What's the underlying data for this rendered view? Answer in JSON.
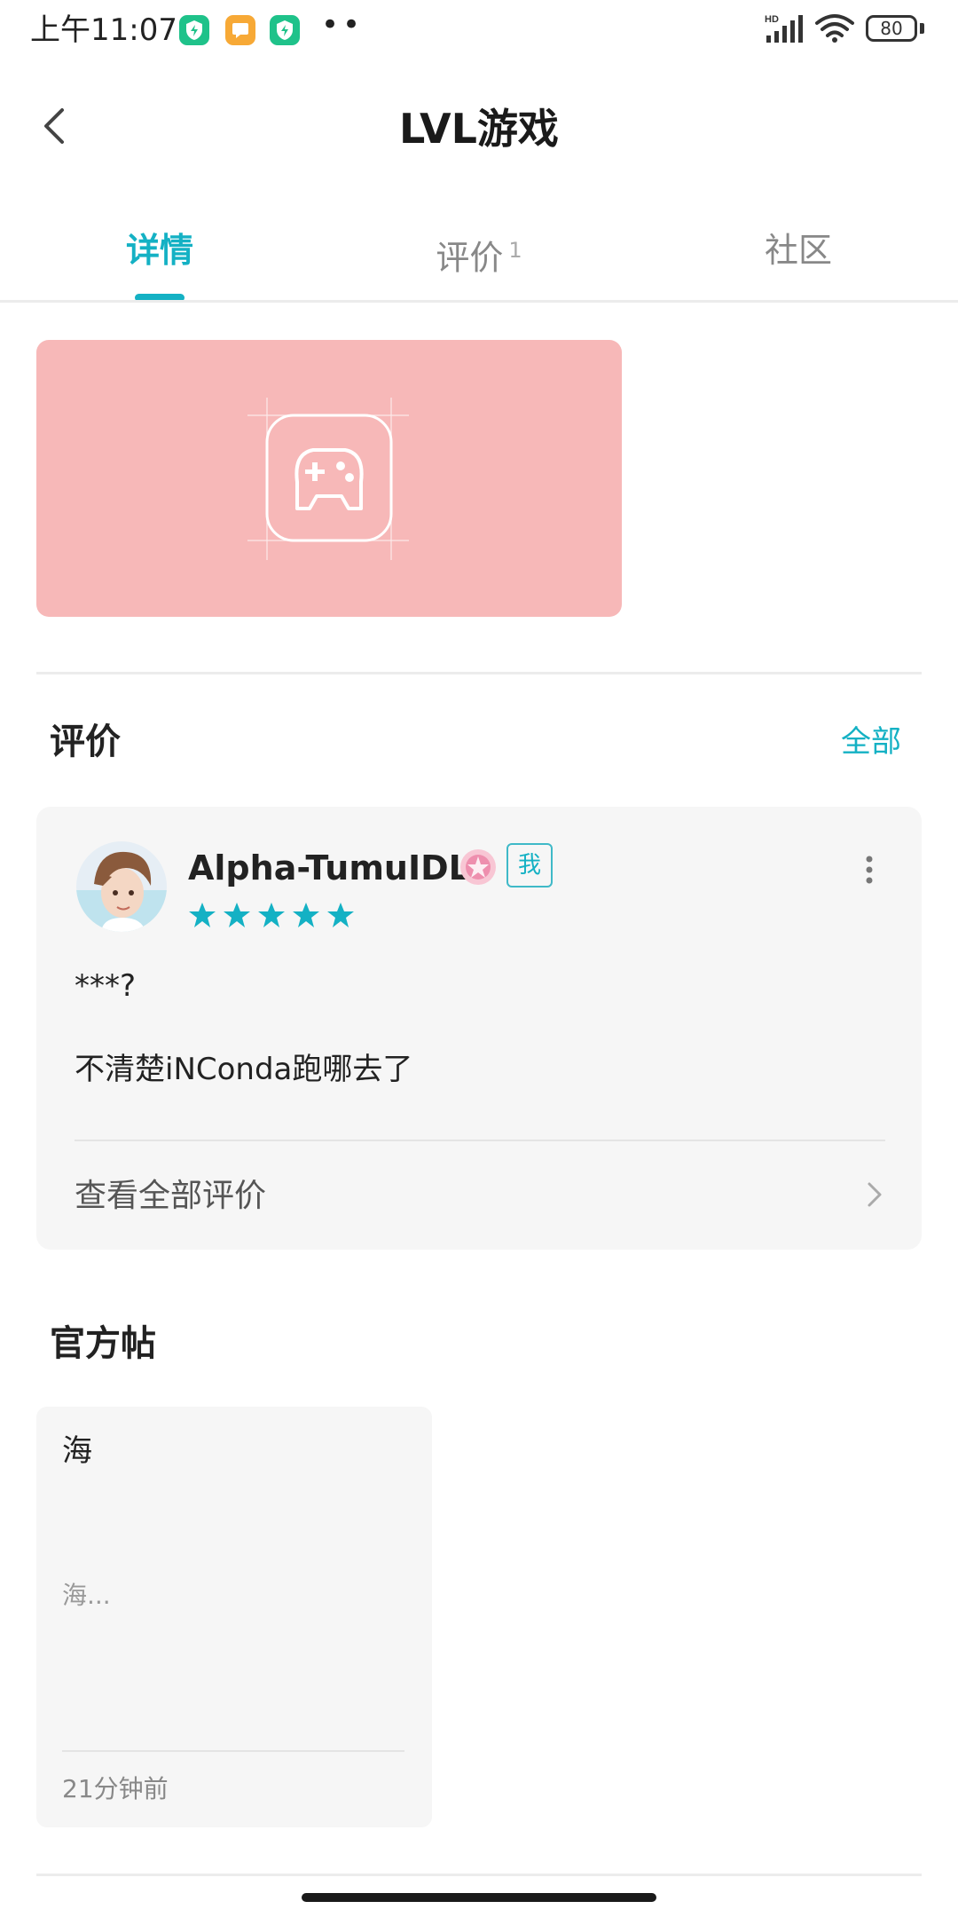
{
  "status_bar": {
    "time": "上午11:07",
    "battery": "80",
    "network_label": "HD",
    "more_dots": "••"
  },
  "header": {
    "title": "LVL游戏"
  },
  "tabs": [
    {
      "label": "详情",
      "active": true
    },
    {
      "label": "评价",
      "count": "1",
      "active": false
    },
    {
      "label": "社区",
      "active": false
    }
  ],
  "reviews_section": {
    "title": "评价",
    "see_all": "全部",
    "review": {
      "username": "Alpha-TumuIDLE",
      "me_badge": "我",
      "rating": 5,
      "line1": "***?",
      "line2": "不清楚iNConda跑哪去了"
    },
    "view_all_label": "查看全部评价"
  },
  "official_posts": {
    "title": "官方帖",
    "post": {
      "title": "海",
      "preview": "海...",
      "time": "21分钟前"
    }
  },
  "colors": {
    "accent": "#14b1c4",
    "banner": "#f7b8b8",
    "card_bg": "#f6f6f6"
  }
}
